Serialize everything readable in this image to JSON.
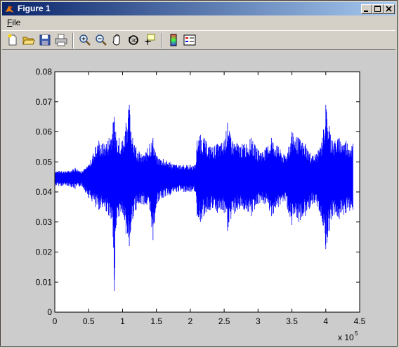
{
  "window": {
    "title": "Figure 1"
  },
  "menu": {
    "file_label": "File",
    "file_mnemonic": "F",
    "file_rest": "ile"
  },
  "toolbar": {
    "icons": [
      "new-figure-icon",
      "open-file-icon",
      "save-icon",
      "print-icon",
      "zoom-in-icon",
      "zoom-out-icon",
      "pan-hand-icon",
      "rotate-3d-icon",
      "data-cursor-icon",
      "colorbar-icon",
      "legend-icon"
    ]
  },
  "colors": {
    "series": "#0000ff",
    "titlebar_start": "#0a246a",
    "titlebar_end": "#a6caf0",
    "figure_bg": "#cccccc"
  },
  "chart_data": {
    "type": "line",
    "title": "",
    "xlabel": "",
    "ylabel": "",
    "x_exponent_label": "x 10",
    "x_exponent": "5",
    "xlim": [
      0,
      4.5
    ],
    "ylim": [
      0,
      0.08
    ],
    "xticks": [
      "0",
      "0.5",
      "1",
      "1.5",
      "2",
      "2.5",
      "3",
      "3.5",
      "4",
      "4.5"
    ],
    "yticks": [
      "0",
      "0.01",
      "0.02",
      "0.03",
      "0.04",
      "0.05",
      "0.06",
      "0.07",
      "0.08"
    ],
    "grid": false,
    "series": [
      {
        "color": "#0000ff",
        "x": [
          0,
          0.1,
          0.2,
          0.3,
          0.4,
          0.5,
          0.6,
          0.65,
          0.7,
          0.8,
          0.86,
          0.88,
          0.9,
          0.95,
          1.0,
          1.05,
          1.1,
          1.15,
          1.2,
          1.3,
          1.4,
          1.45,
          1.5,
          1.6,
          1.7,
          1.8,
          1.9,
          2.0,
          2.08,
          2.1,
          2.15,
          2.2,
          2.3,
          2.4,
          2.5,
          2.55,
          2.6,
          2.7,
          2.8,
          2.9,
          3.0,
          3.1,
          3.2,
          3.3,
          3.4,
          3.45,
          3.5,
          3.6,
          3.7,
          3.8,
          3.9,
          3.95,
          4.0,
          4.05,
          4.1,
          4.2,
          4.3,
          4.4
        ],
        "y_max": [
          0.047,
          0.047,
          0.047,
          0.048,
          0.047,
          0.049,
          0.055,
          0.057,
          0.056,
          0.058,
          0.063,
          0.065,
          0.06,
          0.058,
          0.057,
          0.063,
          0.069,
          0.058,
          0.055,
          0.052,
          0.056,
          0.058,
          0.052,
          0.051,
          0.05,
          0.049,
          0.049,
          0.049,
          0.049,
          0.057,
          0.059,
          0.058,
          0.055,
          0.056,
          0.057,
          0.063,
          0.058,
          0.056,
          0.056,
          0.058,
          0.054,
          0.054,
          0.058,
          0.055,
          0.052,
          0.055,
          0.06,
          0.058,
          0.056,
          0.052,
          0.054,
          0.058,
          0.069,
          0.062,
          0.057,
          0.058,
          0.057,
          0.056
        ],
        "y_min": [
          0.042,
          0.042,
          0.042,
          0.041,
          0.042,
          0.038,
          0.035,
          0.034,
          0.035,
          0.032,
          0.025,
          0.007,
          0.028,
          0.032,
          0.033,
          0.026,
          0.022,
          0.031,
          0.034,
          0.036,
          0.034,
          0.024,
          0.036,
          0.038,
          0.039,
          0.04,
          0.04,
          0.04,
          0.04,
          0.032,
          0.03,
          0.032,
          0.034,
          0.033,
          0.033,
          0.027,
          0.031,
          0.034,
          0.034,
          0.032,
          0.036,
          0.036,
          0.032,
          0.035,
          0.037,
          0.033,
          0.029,
          0.03,
          0.032,
          0.036,
          0.034,
          0.03,
          0.021,
          0.027,
          0.032,
          0.031,
          0.033,
          0.034
        ]
      }
    ]
  }
}
